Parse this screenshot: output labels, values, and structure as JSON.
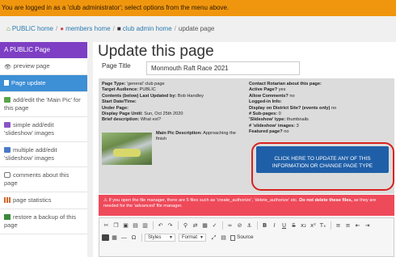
{
  "banner": {
    "text": "You are logged in as a 'club administrator'; select options from the menu above."
  },
  "breadcrumb": {
    "items": [
      "PUBLIC home",
      "members home",
      "club admin home",
      "update page"
    ]
  },
  "sidebar": {
    "header": "A PUBLIC Page",
    "items": [
      {
        "label": "preview page",
        "icon": "eye-icon"
      },
      {
        "label": "Page update",
        "icon": "page-icon",
        "active": true
      },
      {
        "label": "add/edit the 'Main Pic' for this page",
        "icon": "image-icon"
      },
      {
        "label": "simple add/edit 'slideshow' images",
        "icon": "image-icon"
      },
      {
        "label": "multiple add/edit 'slideshow' images",
        "icon": "image-icon"
      },
      {
        "label": "comments about this page",
        "icon": "comment-icon"
      },
      {
        "label": "page statistics",
        "icon": "bar-chart-icon"
      },
      {
        "label": "restore a backup of this page",
        "icon": "restore-icon"
      }
    ]
  },
  "main": {
    "title": "Update this page",
    "page_title_label": "Page Title",
    "page_title_value": "Monmouth Raft Race 2021",
    "info_left": [
      {
        "k": "Page Type:",
        "v": " 'general' club page"
      },
      {
        "k": "Target Audience:",
        "v": " PUBLIC"
      },
      {
        "k": "Contents (below) Last Updated by:",
        "v": " Bob Handley"
      },
      {
        "k": "Start Date/Time:",
        "v": ""
      },
      {
        "k": "Under Page:",
        "v": ""
      },
      {
        "k": "Display Page Until:",
        "v": " Sun, Oct 25th 2020"
      },
      {
        "k": "Brief description:",
        "v": " What ext?"
      }
    ],
    "info_right": [
      {
        "k": "Contact Rotarian about this page:",
        "v": ""
      },
      {
        "k": "Active Page?",
        "v": " yes"
      },
      {
        "k": "Allow Comments?",
        "v": " no"
      },
      {
        "k": "Logged-in Info:",
        "v": ""
      },
      {
        "k": "Display on District Site? (events only)",
        "v": " no"
      },
      {
        "k": "# Sub-pages:",
        "v": " 0"
      },
      {
        "k": "'Slideshow' type:",
        "v": " thumbnails"
      },
      {
        "k": "# 'slideshow' images:",
        "v": " 3"
      },
      {
        "k": "Featured page?",
        "v": " no"
      }
    ],
    "main_pic_desc_label": "Main Pic Description:",
    "main_pic_desc_value": " Approaching the finish",
    "cta_label": "CLICK HERE TO UPDATE ANY OF THIS INFORMATION OR CHANGE PAGE TYPE",
    "alert_text": "If you open the file manager, there are 5 files such as 'create_authorize', 'delete_authorize' etc.",
    "alert_bold": "Do not delete these files,",
    "alert_tail": "as they are needed for the 'advanced' file manager."
  },
  "editor": {
    "styles_label": "Styles",
    "format_label": "Format",
    "source_label": "Source"
  },
  "colors": {
    "banner": "#f0960e",
    "sidebar_header": "#7e3fc4",
    "active_item": "#3d8fd6",
    "cta": "#1f5fa8",
    "alert": "#ee4a5a",
    "highlight_ring": "#d8221e"
  }
}
